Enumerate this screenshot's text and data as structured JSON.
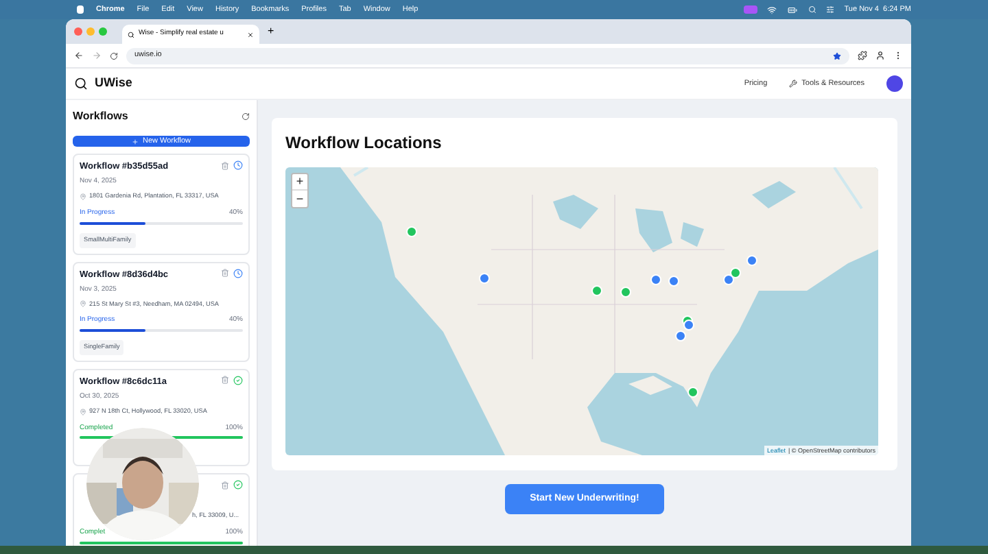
{
  "menu_bar": {
    "app": "Chrome",
    "items": [
      "File",
      "Edit",
      "View",
      "History",
      "Bookmarks",
      "Profiles",
      "Tab",
      "Window",
      "Help"
    ],
    "clock": "Tue Nov 4  6:24 PM"
  },
  "browser": {
    "tab_title": "Wise - Simplify real estate u",
    "new_tab": "+",
    "url": "uwise.io"
  },
  "header": {
    "brand": "UWise",
    "links": [
      "Pricing",
      "Tools & Resources"
    ]
  },
  "sidebar": {
    "title": "Workflows",
    "new_button": "New Workflow",
    "cards": [
      {
        "title": "Workflow #b35d55ad",
        "date": "Nov 4, 2025",
        "address": "1801 Gardenia Rd, Plantation, FL 33317, USA",
        "status": "In Progress",
        "kind": "in_progress",
        "percent": "40%",
        "level": 0.4,
        "tag": "SmallMultiFamily"
      },
      {
        "title": "Workflow #8d36d4bc",
        "date": "Nov 3, 2025",
        "address": "215 St Mary St #3, Needham, MA 02494, USA",
        "status": "In Progress",
        "kind": "in_progress",
        "percent": "40%",
        "level": 0.4,
        "tag": "SingleFamily"
      },
      {
        "title": "Workflow #8c6dc11a",
        "date": "Oct 30, 2025",
        "address": "927 N 18th Ct, Hollywood, FL 33020, USA",
        "status": "Completed",
        "kind": "completed",
        "percent": "100%",
        "level": 1
      },
      {
        "address": "h, FL 33009, U...",
        "status": "Complet",
        "kind": "completed",
        "percent": "100%",
        "level": 1
      }
    ]
  },
  "map": {
    "title": "Workflow Locations",
    "zoom_in": "+",
    "zoom_out": "−",
    "attribution_link": "Leaflet",
    "attribution": "| © OpenStreetMap contributors",
    "markers": [
      {
        "color": "#22c55e"
      },
      {
        "color": "#3b82f6"
      },
      {
        "color": "#22c55e"
      },
      {
        "color": "#22c55e"
      },
      {
        "color": "#3b82f6"
      },
      {
        "color": "#3b82f6"
      },
      {
        "color": "#22c55e"
      },
      {
        "color": "#3b82f6"
      },
      {
        "color": "#3b82f6"
      },
      {
        "color": "#22c55e"
      },
      {
        "color": "#3b82f6"
      },
      {
        "color": "#3b82f6"
      },
      {
        "color": "#22c55e"
      }
    ]
  },
  "cta": "Start New Underwriting!"
}
